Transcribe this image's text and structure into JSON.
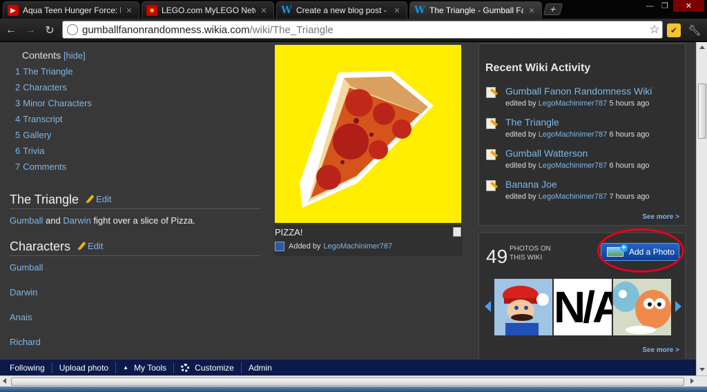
{
  "browser": {
    "tabs": [
      {
        "label": "Aqua Teen Hunger Force: F",
        "icon": "youtube-icon"
      },
      {
        "label": "LEGO.com MyLEGO Networ",
        "icon": "lego-icon"
      },
      {
        "label": "Create a new blog post - Gu",
        "icon": "wikia-icon"
      },
      {
        "label": "The Triangle - Gumball Fan",
        "icon": "wikia-icon"
      }
    ],
    "new_tab_label": "+",
    "url_host": "gumballfanonrandomness.wikia.com",
    "url_path": "/wiki/The_Triangle"
  },
  "toc": {
    "title": "Contents",
    "toggle": "[hide]",
    "items": [
      {
        "num": "1",
        "label": "The Triangle"
      },
      {
        "num": "2",
        "label": "Characters"
      },
      {
        "num": "3",
        "label": "Minor Characters"
      },
      {
        "num": "4",
        "label": "Transcript"
      },
      {
        "num": "5",
        "label": "Gallery"
      },
      {
        "num": "6",
        "label": "Trivia"
      },
      {
        "num": "7",
        "label": "Comments"
      }
    ]
  },
  "article": {
    "section1_title": "The Triangle",
    "edit_label": "Edit",
    "summary_link1": "Gumball",
    "summary_and": " and ",
    "summary_link2": "Darwin",
    "summary_rest": " fight over a slice of Pizza.",
    "section2_title": "Characters",
    "characters": [
      "Gumball",
      "Darwin",
      "Anais",
      "Richard"
    ]
  },
  "image": {
    "caption": "PIZZA!",
    "added_by_label": "Added by",
    "added_by_user": "LegoMachinimer787"
  },
  "activity": {
    "title": "Recent Wiki Activity",
    "items": [
      {
        "title": "Gumball Fanon Randomness Wiki",
        "prefix": "edited by",
        "user": "LegoMachinimer787",
        "time": "5 hours ago"
      },
      {
        "title": "The Triangle",
        "prefix": "edited by",
        "user": "LegoMachinimer787",
        "time": "6 hours ago"
      },
      {
        "title": "Gumball Watterson",
        "prefix": "edited by",
        "user": "LegoMachinimer787",
        "time": "6 hours ago"
      },
      {
        "title": "Banana Joe",
        "prefix": "edited by",
        "user": "LegoMachinimer787",
        "time": "7 hours ago"
      }
    ],
    "see_more": "See more >"
  },
  "photos": {
    "count": "49",
    "count_label": "PHOTOS ON THIS WIKI",
    "add_label": "Add a Photo",
    "see_more": "See more >",
    "thumb_text": "N/A"
  },
  "wikibar": {
    "items": [
      "Following",
      "Upload photo",
      "My Tools",
      "Customize",
      "Admin"
    ]
  },
  "colors": {
    "link": "#7eb6e8",
    "page_bg": "#383838",
    "image_bg": "#ffee00",
    "highlight": "#e8001c",
    "wikibar_bg": "#0b1a4a"
  }
}
